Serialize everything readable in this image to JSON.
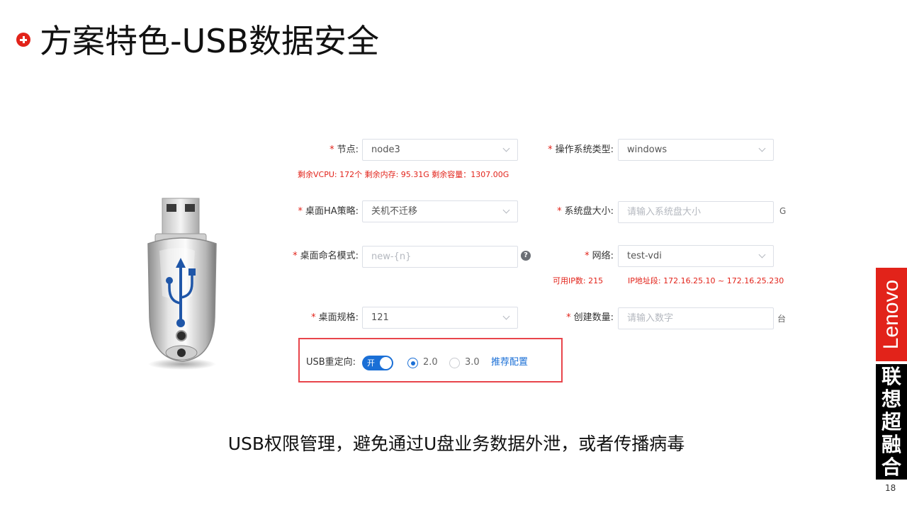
{
  "slide": {
    "title": "方案特色-USB数据安全",
    "caption": "USB权限管理，避免通过U盘业务数据外泄，或者传播病毒",
    "page_number": "18"
  },
  "brand": {
    "logo_text": "Lenovo",
    "chars": [
      "联",
      "想",
      "超",
      "融",
      "合"
    ]
  },
  "form": {
    "node": {
      "label": "节点:",
      "value": "node3"
    },
    "resource_hint": "剩余VCPU: 172个 剩余内存: 95.31G  剩余容量：1307.00G",
    "os_type": {
      "label": "操作系统类型:",
      "value": "windows"
    },
    "ha_policy": {
      "label": "桌面HA策略:",
      "value": "关机不迁移"
    },
    "disk_size": {
      "label": "系统盘大小:",
      "placeholder": "请输入系统盘大小",
      "unit": "G"
    },
    "naming_mode": {
      "label": "桌面命名模式:",
      "placeholder": "new-{n}",
      "help": "?"
    },
    "network": {
      "label": "网络:",
      "value": "test-vdi",
      "hint_ip_count": "可用IP数: 215",
      "hint_ip_range": "IP地址段: 172.16.25.10 ~ 172.16.25.230"
    },
    "spec": {
      "label": "桌面规格:",
      "value": "121"
    },
    "create_count": {
      "label": "创建数量:",
      "placeholder": "请输入数字",
      "unit": "台"
    },
    "usb_redirect": {
      "label": "USB重定向:",
      "toggle_text": "开",
      "enabled": true,
      "options": [
        "2.0",
        "3.0"
      ],
      "selected": "2.0",
      "link": "推荐配置"
    }
  },
  "colors": {
    "accent_red": "#e2231a",
    "toggle_blue": "#1a6fd6",
    "highlight_border": "#e8454b"
  }
}
